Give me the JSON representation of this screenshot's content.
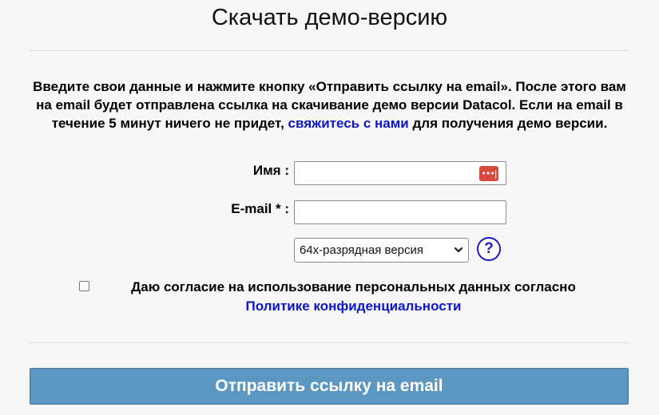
{
  "page": {
    "title": "Скачать демо-версию"
  },
  "intro": {
    "text_before_link": "Введите свои данные и нажмите кнопку «Отправить ссылку на email». После этого вам на email будет отправлена ссылка на скачивание демо версии Datacol. Если на email в течение 5 минут ничего не придет, ",
    "link_text": "свяжитесь с нами",
    "text_after_link": " для получения демо версии."
  },
  "form": {
    "name_label": "Имя :",
    "name_value": "",
    "password_manager_badge": "•••|",
    "email_label": "E-mail * :",
    "email_value": "",
    "version_select": {
      "selected": "64х-разрядная версия",
      "chevron_icon": "chevron-down-icon"
    },
    "help_icon": "?",
    "consent_checked": false,
    "consent_text": "Даю согласие на использование персональных данных согласно",
    "consent_link_text": "Политике конфиденциальности",
    "submit_label": "Отправить ссылку на email"
  },
  "colors": {
    "background": "#f7f7f7",
    "link": "#0b15c9",
    "submit_button": "#5b97c1",
    "password_badge": "#d9483b",
    "help_icon": "#1b1bc4"
  }
}
